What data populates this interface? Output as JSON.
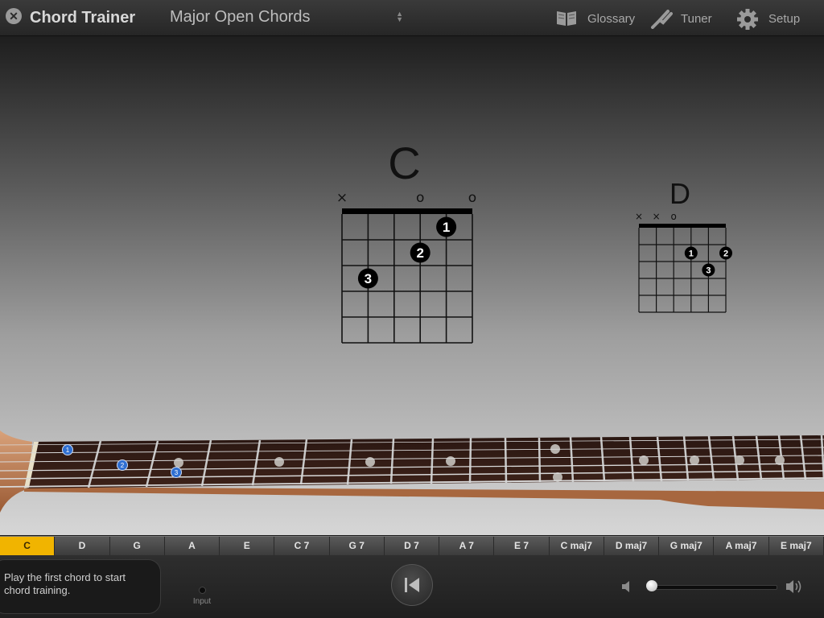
{
  "titlebar": {
    "close_icon": "close-icon",
    "app_title": "Chord Trainer",
    "lesson": "Major Open Chords",
    "glossary_label": "Glossary",
    "tuner_label": "Tuner",
    "setup_label": "Setup"
  },
  "main_chord": {
    "name": "C",
    "string_markers": [
      "×",
      "",
      "",
      "o",
      "",
      "o"
    ],
    "fingers": [
      {
        "string": 5,
        "fret": 1,
        "finger": "1"
      },
      {
        "string": 4,
        "fret": 2,
        "finger": "2"
      },
      {
        "string": 2,
        "fret": 3,
        "finger": "3"
      }
    ]
  },
  "next_chord": {
    "name": "D",
    "string_markers": [
      "×",
      "×",
      "o",
      "",
      "",
      ""
    ],
    "fingers": [
      {
        "string": 4,
        "fret": 2,
        "finger": "1"
      },
      {
        "string": 6,
        "fret": 2,
        "finger": "2"
      },
      {
        "string": 5,
        "fret": 3,
        "finger": "3"
      }
    ]
  },
  "fretboard_notes": [
    "1",
    "2",
    "3"
  ],
  "chord_tabs": [
    "C",
    "D",
    "G",
    "A",
    "E",
    "C 7",
    "G 7",
    "D 7",
    "A 7",
    "E 7",
    "C maj7",
    "D maj7",
    "G maj7",
    "A maj7",
    "E maj7"
  ],
  "active_chord": "C",
  "status_text": "Play the first chord to start chord training.",
  "input_label": "Input",
  "volume": 0.0,
  "colors": {
    "accent": "#f1b400",
    "finger_dot_fretboard": "#2f6fd1"
  }
}
